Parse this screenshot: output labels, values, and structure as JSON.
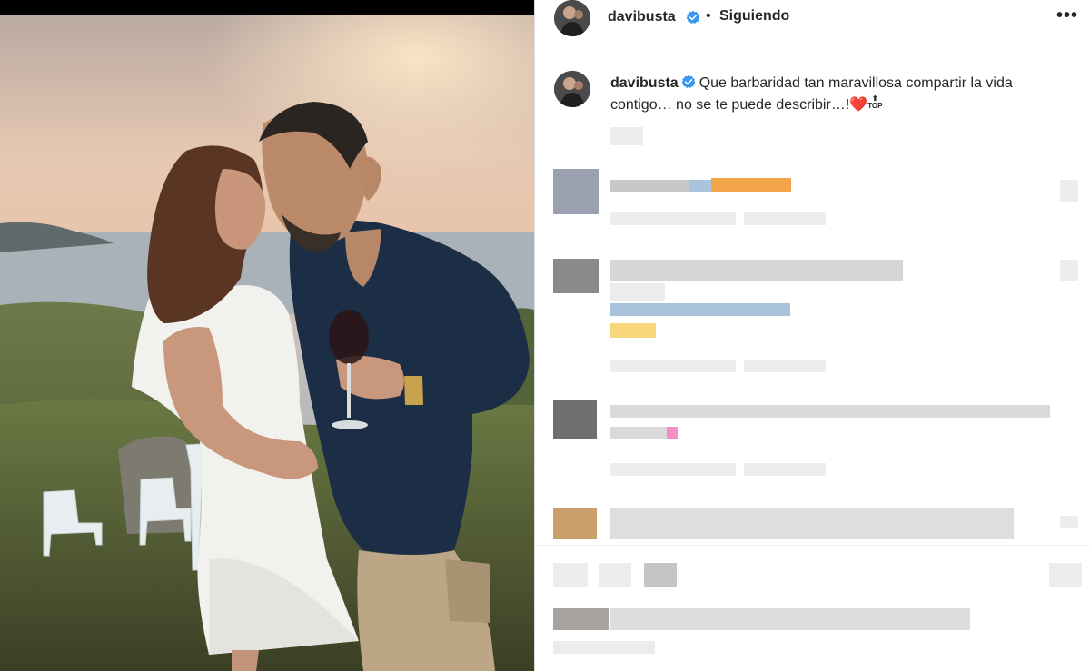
{
  "post": {
    "username": "davibusta",
    "follow_status": "Siguiendo",
    "separator": "•",
    "more_label": "•••",
    "caption_text": "Que barbaridad tan maravillosa compartir la vida contigo… no se te puede describir…!",
    "caption_heart": "❤️",
    "caption_top_arrow": "⬆",
    "caption_top_word": "TOP"
  },
  "colors": {
    "verified_blue": "#3897f0",
    "text": "#262626",
    "border": "#dbdbdb"
  },
  "icons": {
    "verified": "verified-badge-icon",
    "more": "more-options-icon",
    "heart": "red-heart-emoji",
    "top": "top-arrow-emoji"
  }
}
